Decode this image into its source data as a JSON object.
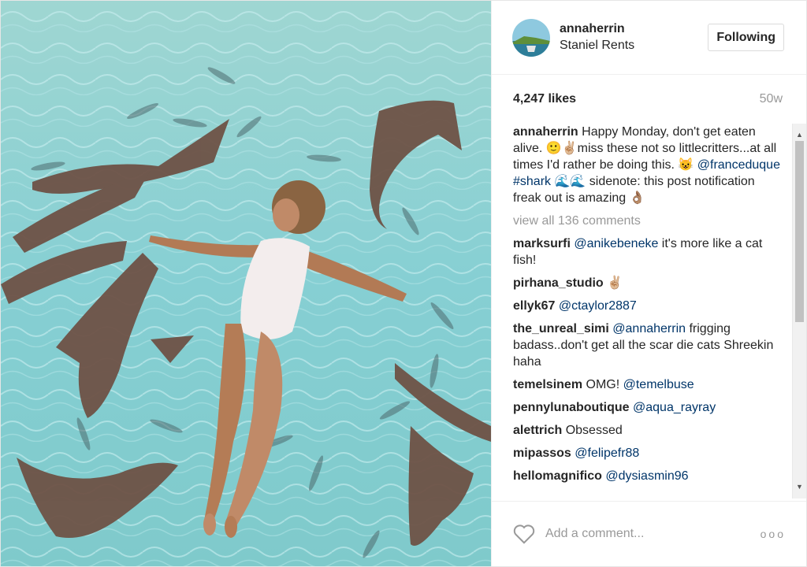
{
  "post": {
    "username": "annaherrin",
    "location": "Staniel Rents",
    "follow_label": "Following",
    "likes": "4,247 likes",
    "age": "50w",
    "caption_user": "annaherrin",
    "caption_parts": [
      "Happy Monday, don't get eaten alive. ",
      "🙂✌🏼",
      "miss these not so littlecritters...at all times I'd rather be doing this. ",
      "😺 ",
      "@franceduque",
      " ",
      "#shark",
      " 🌊🌊 sidenote: this post notification freak out is amazing 👌🏽"
    ],
    "view_all": "view all 136 comments",
    "add_comment_placeholder": "Add a comment...",
    "more_label": "ooo"
  },
  "comments": [
    {
      "user": "marksurfi",
      "mention": "@anikebeneke",
      "text": " it's more like a cat fish!"
    },
    {
      "user": "pirhana_studio",
      "mention": "",
      "text": "✌🏼"
    },
    {
      "user": "ellyk67",
      "mention": "@ctaylor2887",
      "text": ""
    },
    {
      "user": "the_unreal_simi",
      "mention": "@annaherrin",
      "text": " frigging badass..don't get all the scar die cats Shreekin haha"
    },
    {
      "user": "temelsinem",
      "mention": "",
      "text": "OMG! ",
      "mention2": "@temelbuse"
    },
    {
      "user": "pennylunaboutique",
      "mention": "@aqua_rayray",
      "text": ""
    },
    {
      "user": "alettrich",
      "mention": "",
      "text": "Obsessed"
    },
    {
      "user": "mipassos",
      "mention": "@felipefr88",
      "text": ""
    },
    {
      "user": "hellomagnifico",
      "mention": "@dysiasmin96",
      "text": ""
    }
  ],
  "colors": {
    "water": "#8fd3d6",
    "shark": "#6e5246",
    "link": "#003569",
    "muted": "#999999"
  },
  "icons": {
    "heart": "heart-icon",
    "more": "more-options-icon"
  }
}
